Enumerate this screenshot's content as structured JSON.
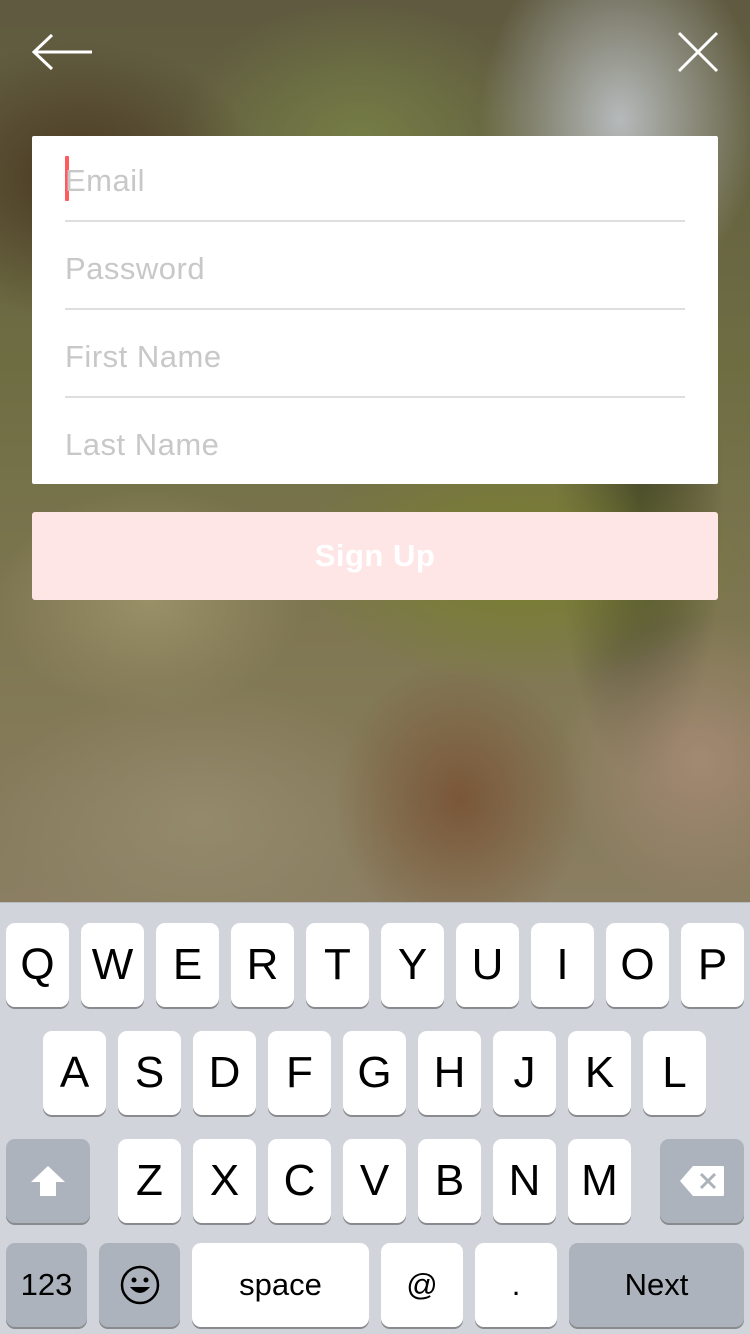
{
  "nav": {
    "back_icon": "arrow-left-icon",
    "close_icon": "close-icon",
    "icon_color": "#ffffff"
  },
  "form": {
    "fields": [
      {
        "name": "email",
        "placeholder": "Email",
        "value": "",
        "focused": true
      },
      {
        "name": "password",
        "placeholder": "Password",
        "value": ""
      },
      {
        "name": "first_name",
        "placeholder": "First Name",
        "value": ""
      },
      {
        "name": "last_name",
        "placeholder": "Last Name",
        "value": ""
      }
    ],
    "cursor_color": "#ff5a5f"
  },
  "signup_button": {
    "label": "Sign Up",
    "background": "#ffe6e6",
    "enabled": false
  },
  "keyboard": {
    "row1": [
      "Q",
      "W",
      "E",
      "R",
      "T",
      "Y",
      "U",
      "I",
      "O",
      "P"
    ],
    "row2": [
      "A",
      "S",
      "D",
      "F",
      "G",
      "H",
      "J",
      "K",
      "L"
    ],
    "row3": [
      "Z",
      "X",
      "C",
      "V",
      "B",
      "N",
      "M"
    ],
    "shift_icon": "shift-icon",
    "delete_icon": "backspace-icon",
    "numbers_label": "123",
    "emoji_icon": "emoji-icon",
    "space_label": "space",
    "at_label": "@",
    "dot_label": ".",
    "next_label": "Next"
  }
}
